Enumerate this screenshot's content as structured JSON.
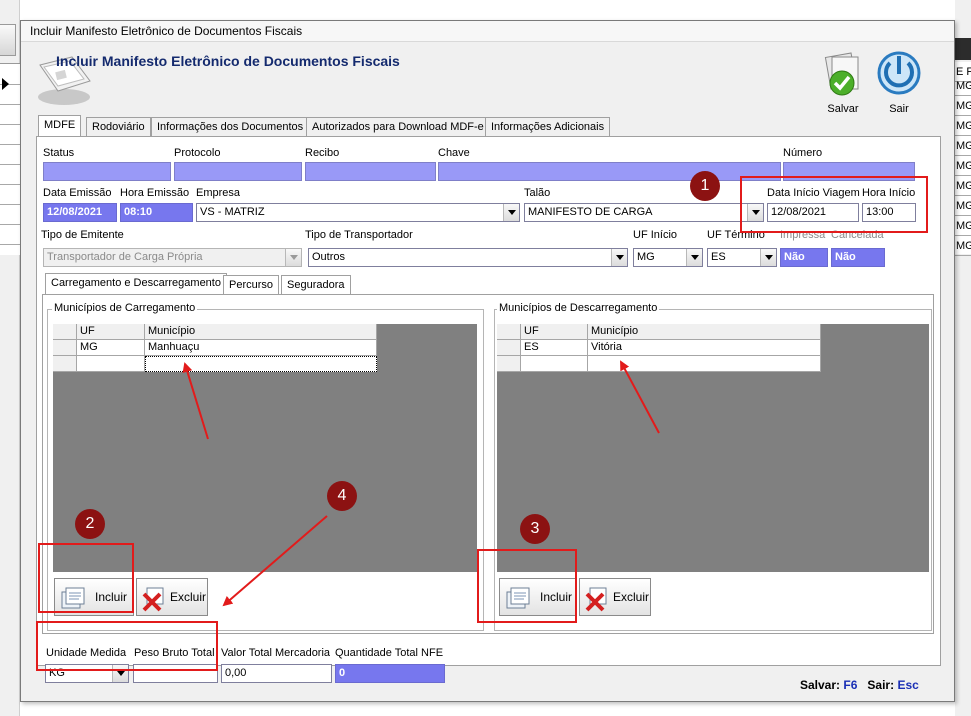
{
  "window": {
    "title": "Incluir Manifesto Eletrônico de Documentos Fiscais"
  },
  "header": {
    "title": "Incluir Manifesto Eletrônico de Documentos Fiscais"
  },
  "toolbar": {
    "save_label": "Salvar",
    "exit_label": "Sair"
  },
  "background": {
    "right_cells": [
      "E F",
      "MG",
      "MG",
      "MG",
      "MG",
      "MG",
      "MG",
      "MG",
      "MG",
      "MG"
    ]
  },
  "tabs": [
    "MDFE",
    "Rodoviário",
    "Informações dos Documentos",
    "Autorizados para Download MDF-e",
    "Informações Adicionais"
  ],
  "mdfe": {
    "status_label": "Status",
    "status_value": "",
    "protocolo_label": "Protocolo",
    "protocolo_value": "",
    "recibo_label": "Recibo",
    "recibo_value": "",
    "chave_label": "Chave",
    "chave_value": "",
    "numero_label": "Número",
    "numero_value": "",
    "data_emissao_label": "Data Emissão",
    "data_emissao_value": "12/08/2021",
    "hora_emissao_label": "Hora Emissão",
    "hora_emissao_value": "08:10",
    "empresa_label": "Empresa",
    "empresa_value": "VS - MATRIZ",
    "talao_label": "Talão",
    "talao_value": "MANIFESTO DE CARGA",
    "data_inicio_label": "Data Início Viagem",
    "data_inicio_value": "12/08/2021",
    "hora_inicio_label": "Hora Início",
    "hora_inicio_value": "13:00",
    "tipo_emitente_label": "Tipo de Emitente",
    "tipo_emitente_value": "Transportador de Carga Própria",
    "tipo_transportador_label": "Tipo de Transportador",
    "tipo_transportador_value": "Outros",
    "uf_inicio_label": "UF Início",
    "uf_inicio_value": "MG",
    "uf_termino_label": "UF Término",
    "uf_termino_value": "ES",
    "impressa_label": "Impressa",
    "impressa_value": "Não",
    "cancelada_label": "Cancelada",
    "cancelada_value": "Não"
  },
  "subtabs": [
    "Carregamento e Descarregamento",
    "Percurso",
    "Seguradora"
  ],
  "carregamento": {
    "title": "Municípios de Carregamento",
    "columns": [
      "UF",
      "Município"
    ],
    "rows": [
      [
        "MG",
        "Manhuaçu"
      ]
    ],
    "add_label": "Incluir",
    "delete_label": "Excluir"
  },
  "descarregamento": {
    "title": "Municípios de Descarregamento",
    "columns": [
      "UF",
      "Município"
    ],
    "rows": [
      [
        "ES",
        "Vitória"
      ]
    ],
    "add_label": "Incluir",
    "delete_label": "Excluir"
  },
  "totals": {
    "unidade_label": "Unidade Medida",
    "unidade_value": "KG",
    "peso_label": "Peso Bruto Total",
    "peso_value": "",
    "valor_label": "Valor Total Mercadoria",
    "valor_value": "0,00",
    "quantidade_label": "Quantidade Total NFE",
    "quantidade_value": "0"
  },
  "shortcuts": {
    "save_label": "Salvar:",
    "save_key": "F6",
    "exit_label": "Sair:",
    "exit_key": "Esc"
  },
  "annotations": [
    "1",
    "2",
    "3",
    "4"
  ],
  "colors": {
    "highlight_field": "#9999f7",
    "annotation_red": "#e21b1b",
    "badge": "#8c1212",
    "title_blue": "#142a6e"
  }
}
